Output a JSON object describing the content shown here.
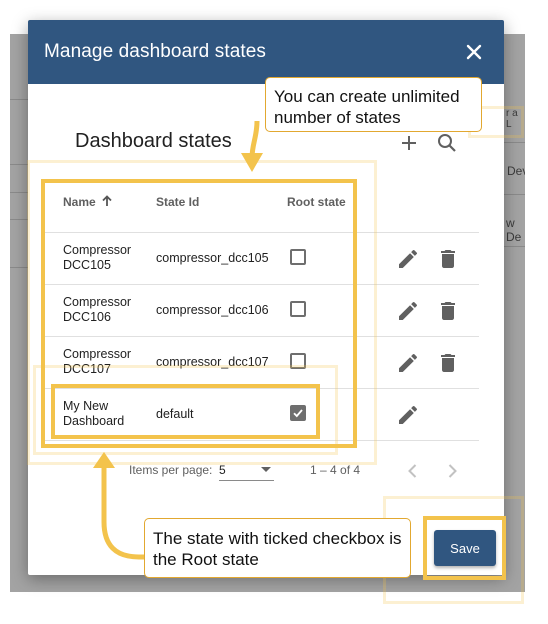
{
  "background": {
    "snippets": [
      "r a L",
      "Dev",
      "w De"
    ]
  },
  "dialog": {
    "title": "Manage dashboard states",
    "section_title": "Dashboard states",
    "columns": {
      "name": "Name",
      "state_id": "State Id",
      "root_state": "Root state"
    },
    "rows": [
      {
        "name": "Compressor DCC105",
        "state_id": "compressor_dcc105",
        "root_state": false,
        "deletable": true
      },
      {
        "name": "Compressor DCC106",
        "state_id": "compressor_dcc106",
        "root_state": false,
        "deletable": true
      },
      {
        "name": "Compressor DCC107",
        "state_id": "compressor_dcc107",
        "root_state": false,
        "deletable": true
      },
      {
        "name": "My New Dashboard",
        "state_id": "default",
        "root_state": true,
        "deletable": false
      }
    ],
    "pager": {
      "label": "Items per page:",
      "page_size": "5",
      "range": "1 – 4 of 4"
    },
    "save_label": "Save"
  },
  "annotations": {
    "top_note": "You can create unlimited number of states",
    "bottom_note": "The state with ticked checkbox is the Root state"
  },
  "colors": {
    "header": "#305680",
    "highlight": "#f3c34c",
    "icon": "#606060"
  }
}
